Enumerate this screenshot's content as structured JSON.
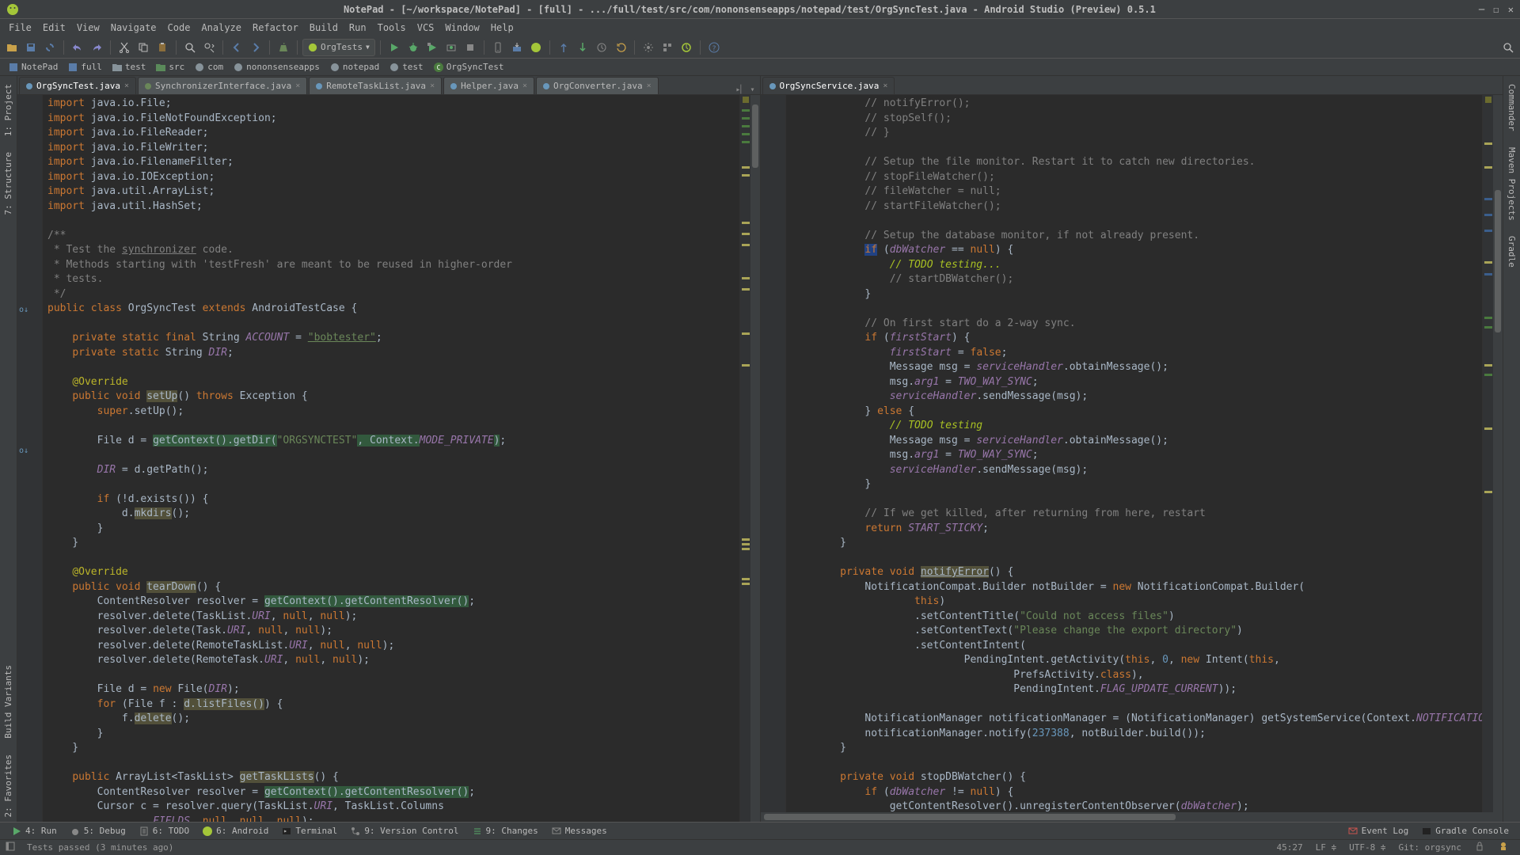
{
  "window": {
    "title": "NotePad - [~/workspace/NotePad] - [full] - .../full/test/src/com/nononsenseapps/notepad/test/OrgSyncTest.java - Android Studio (Preview) 0.5.1"
  },
  "menu": [
    "File",
    "Edit",
    "View",
    "Navigate",
    "Code",
    "Analyze",
    "Refactor",
    "Build",
    "Run",
    "Tools",
    "VCS",
    "Window",
    "Help"
  ],
  "toolbar": {
    "run_config": "OrgTests"
  },
  "breadcrumbs": [
    "NotePad",
    "full",
    "test",
    "src",
    "com",
    "nononsenseapps",
    "notepad",
    "test",
    "OrgSyncTest"
  ],
  "left_tools": [
    "1: Project",
    "7: Structure",
    "Build Variants",
    "2: Favorites"
  ],
  "right_tools": [
    "Commander",
    "Maven Projects",
    "Gradle"
  ],
  "bottom_tools": {
    "run": "4: Run",
    "debug": "5: Debug",
    "todo": "6: TODO",
    "android": "6: Android",
    "terminal": "Terminal",
    "vcs": "9: Version Control",
    "changes": "9: Changes",
    "messages": "Messages",
    "eventlog": "Event Log",
    "gradle": "Gradle Console"
  },
  "status": {
    "msg": "Tests passed (3 minutes ago)",
    "pos": "45:27",
    "lf": "LF",
    "enc": "UTF-8",
    "git": "Git: orgsync"
  },
  "left_tabs": [
    {
      "name": "OrgSyncTest.java",
      "active": true
    },
    {
      "name": "SynchronizerInterface.java",
      "active": false
    },
    {
      "name": "RemoteTaskList.java",
      "active": false
    },
    {
      "name": "Helper.java",
      "active": false
    },
    {
      "name": "OrgConverter.java",
      "active": false
    }
  ],
  "right_tabs": [
    {
      "name": "OrgSyncService.java",
      "active": true
    }
  ],
  "left_code_html": "<span class='kw'>import</span> java.io.File;\n<span class='kw'>import</span> java.io.FileNotFoundException;\n<span class='kw'>import</span> java.io.FileReader;\n<span class='kw'>import</span> java.io.FileWriter;\n<span class='kw'>import</span> java.io.FilenameFilter;\n<span class='kw'>import</span> java.io.IOException;\n<span class='kw'>import</span> java.util.ArrayList;\n<span class='kw'>import</span> java.util.HashSet;\n\n<span class='com'>/**</span>\n<span class='com'> * Test the </span><span class='link'>synchronizer</span><span class='com'> code.</span>\n<span class='com'> * Methods starting with 'testFresh' are meant to be reused in higher-order</span>\n<span class='com'> * tests.</span>\n<span class='com'> */</span>\n<span class='kw'>public class</span> OrgSyncTest <span class='kw'>extends</span> AndroidTestCase {\n\n    <span class='kw'>private static final</span> String <span class='fld'>ACCOUNT</span> = <span class='str'><u>\"bobtester\"</u></span>;\n    <span class='kw'>private static</span> String <span class='fld'>DIR</span>;\n\n    <span class='ann'>@Override</span>\n    <span class='kw'>public void</span> <span class='warn'>setUp</span>() <span class='kw'>throws</span> Exception {\n        <span class='kw'>super</span>.setUp();\n\n        File d = <span class='hi'>getContext().getDir(</span><span class='str'>\"ORGSYNCTEST\"</span><span class='hi'>, Context.</span><span class='fld'>MODE_PRIVATE</span><span class='hi'>)</span>;\n\n        <span class='fld'>DIR</span> = d.getPath();\n\n        <span class='kw'>if</span> (!d.exists()) {\n            d.<span class='warn'>mkdirs</span>();\n        }\n    }\n\n    <span class='ann'>@Override</span>\n    <span class='kw'>public void</span> <span class='warn'>tearDown</span>() {\n        ContentResolver resolver = <span class='hi'>getContext().getContentResolver()</span>;\n        resolver.delete(TaskList.<span class='fld'>URI</span>, <span class='kw'>null</span>, <span class='kw'>null</span>);\n        resolver.delete(Task.<span class='fld'>URI</span>, <span class='kw'>null</span>, <span class='kw'>null</span>);\n        resolver.delete(RemoteTaskList.<span class='fld'>URI</span>, <span class='kw'>null</span>, <span class='kw'>null</span>);\n        resolver.delete(RemoteTask.<span class='fld'>URI</span>, <span class='kw'>null</span>, <span class='kw'>null</span>);\n\n        File d = <span class='kw'>new</span> File(<span class='fld'>DIR</span>);\n        <span class='kw'>for</span> (File f : <span class='warn'>d.listFiles()</span>) {\n            f.<span class='warn'>delete</span>();\n        }\n    }\n\n    <span class='kw'>public</span> ArrayList&lt;TaskList&gt; <span class='warn'>getTaskLists</span>() {\n        ContentResolver resolver = <span class='hi'>getContext().getContentResolver()</span>;\n        Cursor c = resolver.query(TaskList.<span class='fld'>URI</span>, TaskList.Columns\n                .<span class='fld'>FIELDS</span>, <span class='kw'>null</span>, <span class='kw'>null</span>, <span class='kw'>null</span>);\n",
  "right_code_html": "            <span class='com'>// notifyError();</span>\n            <span class='com'>// stopSelf();</span>\n            <span class='com'>// }</span>\n\n            <span class='com'>// Setup the file monitor. Restart it to catch new directories.</span>\n            <span class='com'>// stopFileWatcher();</span>\n            <span class='com'>// fileWatcher = null;</span>\n            <span class='com'>// startFileWatcher();</span>\n\n            <span class='com'>// Setup the database monitor, if not already present.</span>\n            <span class='hi2'><span class='kw'>if</span></span> (<span class='fld'>dbWatcher</span> == <span class='kw'>null</span>) {\n                <span class='todo'>// TODO testing...</span>\n                <span class='com'>// startDBWatcher();</span>\n            }\n\n            <span class='com'>// On first start do a 2-way sync.</span>\n            <span class='kw'>if</span> (<span class='fld'>firstStart</span>) {\n                <span class='fld'>firstStart</span> = <span class='kw'>false</span>;\n                Message msg = <span class='fld'>serviceHandler</span>.obtainMessage();\n                msg.<span class='fld'>arg1</span> = <span class='fld'>TWO_WAY_SYNC</span>;\n                <span class='fld'>serviceHandler</span>.sendMessage(msg);\n            } <span class='kw'>else</span> {\n                <span class='todo'>// TODO testing</span>\n                Message msg = <span class='fld'>serviceHandler</span>.obtainMessage();\n                msg.<span class='fld'>arg1</span> = <span class='fld'>TWO_WAY_SYNC</span>;\n                <span class='fld'>serviceHandler</span>.sendMessage(msg);\n            }\n\n            <span class='com'>// If we get killed, after returning from here, restart</span>\n            <span class='kw'>return</span> <span class='fld'>START_STICKY</span>;\n        }\n\n        <span class='kw'>private void</span> <span class='warn' style='text-decoration:underline'>notifyError</span>() {\n            NotificationCompat.Builder notBuilder = <span class='kw'>new</span> NotificationCompat.Builder(\n                    <span class='kw'>this</span>)\n                    .setContentTitle(<span class='str'>\"Could not access files\"</span>)\n                    .setContentText(<span class='str'>\"Please change the export directory\"</span>)\n                    .setContentIntent(\n                            PendingIntent.getActivity(<span class='kw'>this</span>, <span class='num'>0</span>, <span class='kw'>new</span> Intent(<span class='kw'>this</span>,\n                                    PrefsActivity.<span class='kw'>class</span>),\n                                    PendingIntent.<span class='fld'>FLAG_UPDATE_CURRENT</span>));\n\n            NotificationManager notificationManager = (NotificationManager) getSystemService(Context.<span class='fld'>NOTIFICATION_</span>\n            notificationManager.notify(<span class='num'>237388</span>, notBuilder.build());\n        }\n\n        <span class='kw'>private void</span> stopDBWatcher() {\n            <span class='kw'>if</span> (<span class='fld'>dbWatcher</span> != <span class='kw'>null</span>) {\n                getContentResolver().unregisterContentObserver(<span class='fld'>dbWatcher</span>);\n            }\n"
}
